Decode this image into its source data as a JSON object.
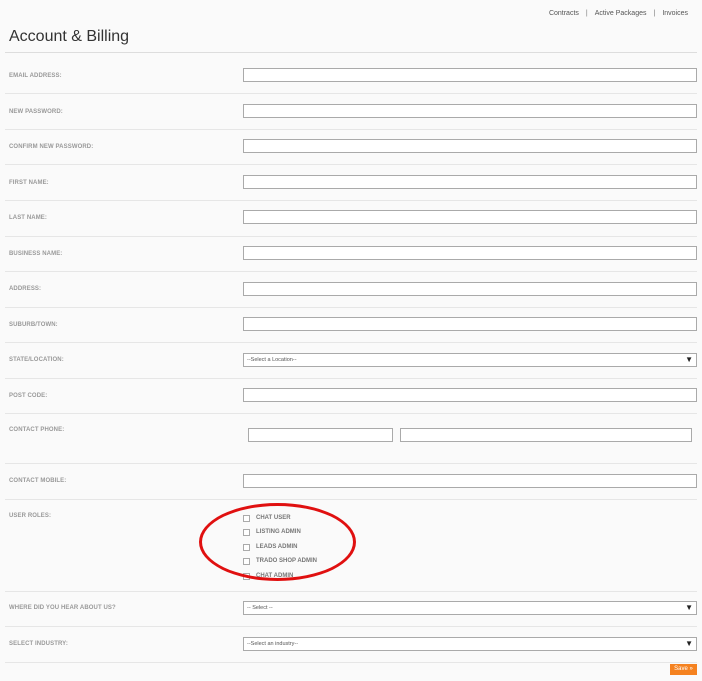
{
  "header": {
    "links": [
      "Contracts",
      "Active Packages",
      "Invoices"
    ],
    "title": "Account & Billing"
  },
  "fields": {
    "email": "EMAIL ADDRESS:",
    "new_password": "NEW PASSWORD:",
    "confirm_password": "CONFIRM NEW PASSWORD:",
    "first_name": "FIRST NAME:",
    "last_name": "LAST NAME:",
    "business_name": "BUSINESS NAME:",
    "address": "ADDRESS:",
    "suburb": "SUBURB/TOWN:",
    "state": "STATE/LOCATION:",
    "postcode": "POST CODE:",
    "contact_phone": "CONTACT PHONE:",
    "contact_mobile": "CONTACT MOBILE:",
    "user_roles": "USER ROLES:",
    "hear_about": "WHERE DID YOU HEAR ABOUT US?",
    "industry": "SELECT INDUSTRY:"
  },
  "selects": {
    "state_value": "--Select a Location--",
    "hear_value": "-- Select --",
    "industry_value": "--Select an industry--",
    "arrow": "▼"
  },
  "roles": [
    {
      "label": "CHAT USER",
      "checked": false
    },
    {
      "label": "LISTING ADMIN",
      "checked": false
    },
    {
      "label": "LEADS ADMIN",
      "checked": false
    },
    {
      "label": "TRADO SHOP ADMIN",
      "checked": false
    },
    {
      "label": "CHAT ADMIN",
      "checked": false
    }
  ],
  "actions": {
    "save": "Save »"
  },
  "colors": {
    "save_button": "#f58220",
    "highlight": "#e01010"
  }
}
